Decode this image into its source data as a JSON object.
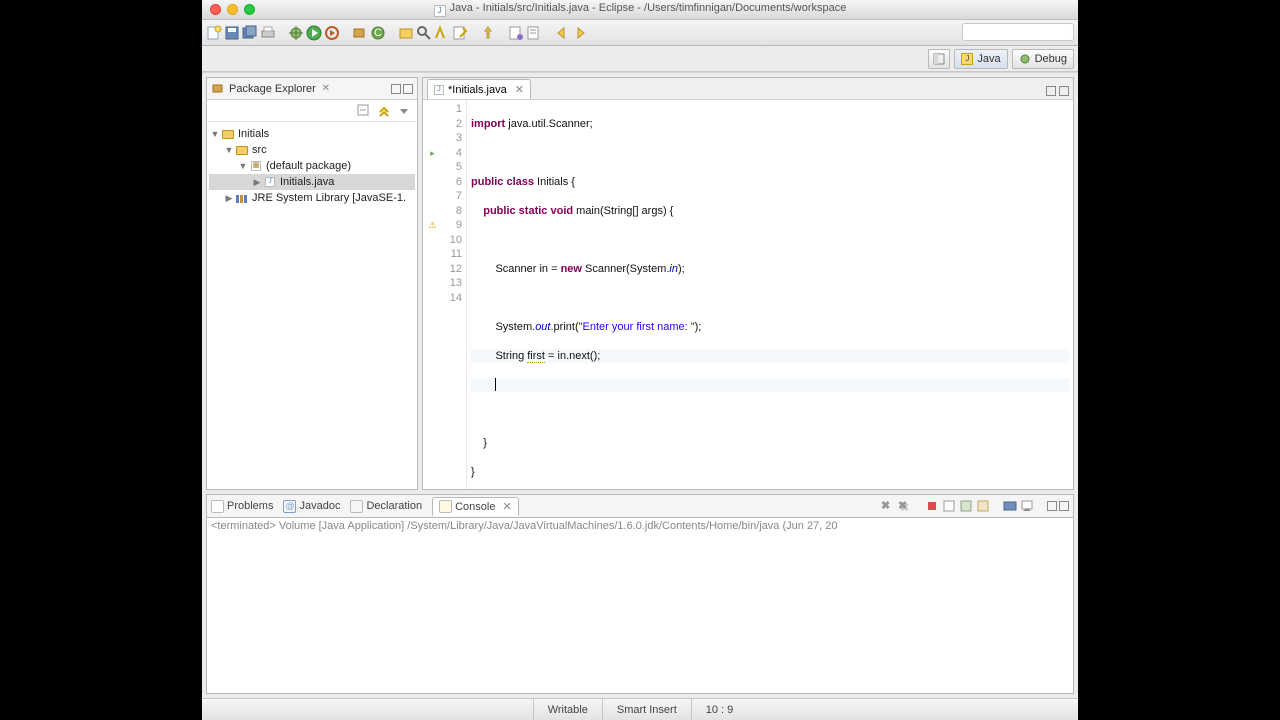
{
  "window": {
    "title": "Java - Initials/src/Initials.java - Eclipse - /Users/timfinnigan/Documents/workspace"
  },
  "perspectives": {
    "java": "Java",
    "debug": "Debug"
  },
  "packageExplorer": {
    "title": "Package Explorer",
    "tree": {
      "project": "Initials",
      "src": "src",
      "pkg": "(default package)",
      "file": "Initials.java",
      "lib": "JRE System Library [JavaSE-1."
    }
  },
  "editor": {
    "tab": "*Initials.java",
    "lineNumbers": [
      "1",
      "2",
      "3",
      "4",
      "5",
      "6",
      "7",
      "8",
      "9",
      "10",
      "11",
      "12",
      "13",
      "14"
    ],
    "code": {
      "l1a": "import",
      "l1b": " java.util.Scanner;",
      "l3a": "public",
      "l3b": " class",
      "l3c": " Initials {",
      "l4a": "    public",
      "l4b": " static",
      "l4c": " void",
      "l4d": " main(String[] args) {",
      "l6a": "        Scanner in = ",
      "l6b": "new",
      "l6c": " Scanner(System.",
      "l6d": "in",
      "l6e": ");",
      "l8a": "        System.",
      "l8b": "out",
      "l8c": ".print(",
      "l8d": "\"Enter your first name: \"",
      "l8e": ");",
      "l9a": "        String ",
      "l9b": "first",
      "l9c": " = in.next();",
      "l12": "    }",
      "l13": "}"
    }
  },
  "consoleTabs": {
    "problems": "Problems",
    "javadoc": "Javadoc",
    "declaration": "Declaration",
    "console": "Console"
  },
  "console": {
    "line": "<terminated> Volume [Java Application] /System/Library/Java/JavaVirtualMachines/1.6.0.jdk/Contents/Home/bin/java (Jun 27, 20"
  },
  "status": {
    "writable": "Writable",
    "insert": "Smart Insert",
    "pos": "10 : 9"
  }
}
